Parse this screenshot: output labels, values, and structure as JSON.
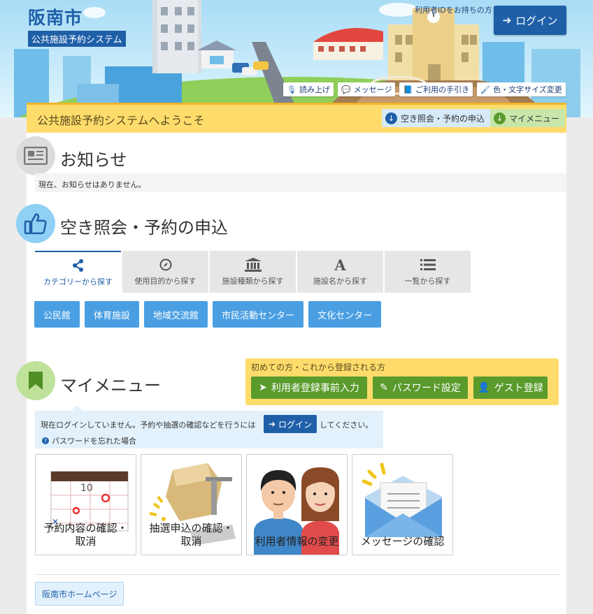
{
  "header": {
    "site_title": "阪南市",
    "site_subtitle": "公共施設予約システム",
    "login_hint": "利用者IDをお持ちの方",
    "login_label": "ログイン",
    "tools": [
      {
        "label": "読み上げ",
        "icon": "microphone-icon"
      },
      {
        "label": "メッセージ",
        "icon": "comment-icon"
      },
      {
        "label": "ご利用の手引き",
        "icon": "book-icon"
      },
      {
        "label": "色・文字サイズ変更",
        "icon": "paintbrush-icon"
      }
    ]
  },
  "welcome": {
    "title": "公共施設予約システムへようこそ",
    "jump_reserve": "空き照会・予約の申込",
    "jump_mymenu": "マイメニュー"
  },
  "news": {
    "title": "お知らせ",
    "message": "現在、お知らせはありません。"
  },
  "reserve": {
    "title": "空き照会・予約の申込",
    "tabs": [
      {
        "label": "カテゴリーから探す",
        "icon": "share-icon"
      },
      {
        "label": "使用目的から探す",
        "icon": "compass-icon"
      },
      {
        "label": "施設種類から探す",
        "icon": "building-icon"
      },
      {
        "label": "施設名から探す",
        "icon": "font-icon"
      },
      {
        "label": "一覧から探す",
        "icon": "list-icon"
      }
    ],
    "categories": [
      "公民館",
      "体育施設",
      "地域交流館",
      "市民活動センター",
      "文化センター"
    ]
  },
  "mymenu": {
    "title": "マイメニュー",
    "newuser_label": "初めての方・これから登録される方",
    "newuser_buttons": [
      "利用者登録事前入力",
      "パスワード設定",
      "ゲスト登録"
    ],
    "login_text_before": "現在ログインしていません。予約や抽選の確認などを行うには",
    "login_button": "ログイン",
    "login_text_after": "してください。",
    "forgot_password": "パスワードを忘れた場合",
    "cards": [
      {
        "label1": "予約内容の確認・",
        "label2": "取消"
      },
      {
        "label1": "抽選申込の確認・",
        "label2": "取消"
      },
      {
        "label1": "利用者情報の変更",
        "label2": ""
      },
      {
        "label1": "メッセージの確認",
        "label2": ""
      }
    ],
    "calendar_day": "10"
  },
  "footer": {
    "homepage_link": "阪南市ホームページ"
  },
  "colors": {
    "primary": "#1f5fa8",
    "yellow": "#fddc6b",
    "green": "#5a9b2c",
    "category_blue": "#4a9fe3"
  }
}
